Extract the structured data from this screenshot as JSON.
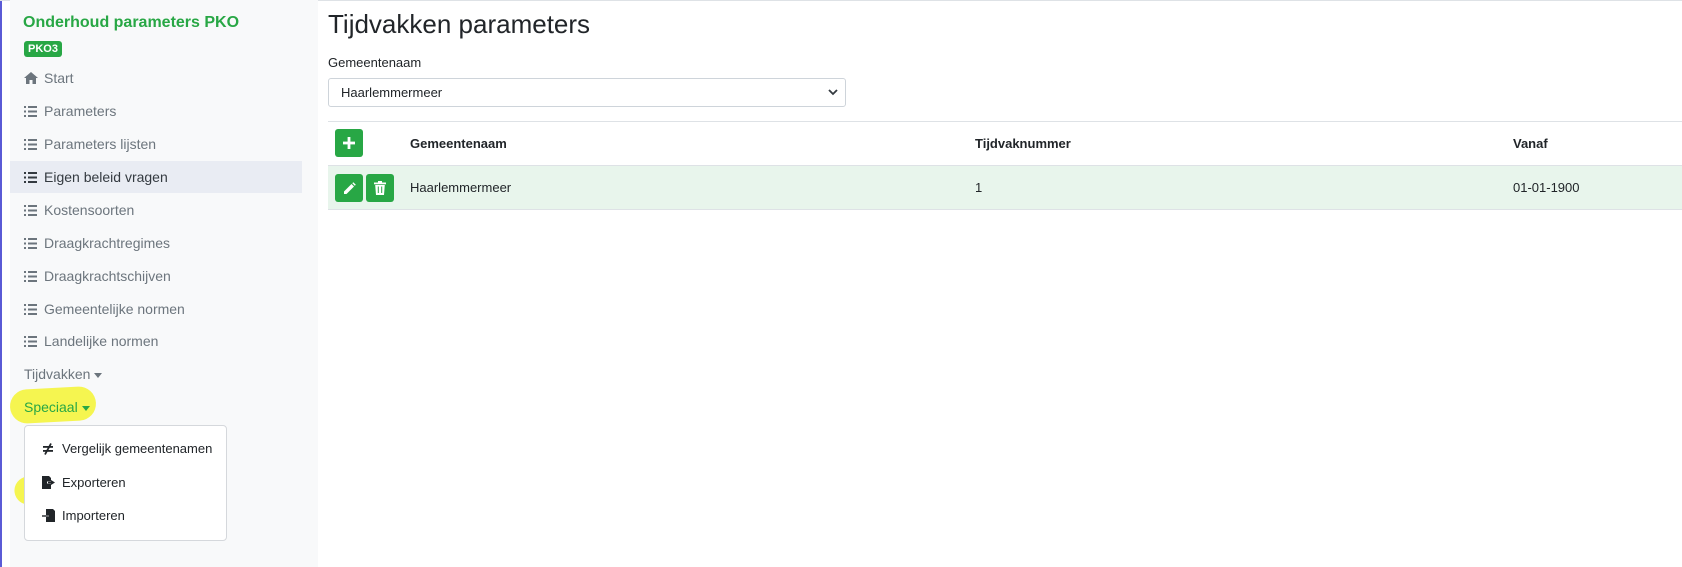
{
  "sidebar": {
    "title": "Onderhoud parameters PKO",
    "badge": "PKO3",
    "items": [
      {
        "label": "Start",
        "icon": "home-icon"
      },
      {
        "label": "Parameters",
        "icon": "list-icon"
      },
      {
        "label": "Parameters lijsten",
        "icon": "list-icon"
      },
      {
        "label": "Eigen beleid vragen",
        "icon": "list-icon"
      },
      {
        "label": "Kostensoorten",
        "icon": "list-icon"
      },
      {
        "label": "Draagkrachtregimes",
        "icon": "list-icon"
      },
      {
        "label": "Draagkrachtschijven",
        "icon": "list-icon"
      },
      {
        "label": "Gemeentelijke normen",
        "icon": "list-icon"
      },
      {
        "label": "Landelijke normen",
        "icon": "list-icon"
      }
    ],
    "dropdowns": [
      {
        "label": "Tijdvakken"
      },
      {
        "label": "Speciaal"
      }
    ],
    "speciaal_menu": [
      {
        "label": "Vergelijk gemeentenamen",
        "icon": "not-equal-icon"
      },
      {
        "label": "Exporteren",
        "icon": "file-export-icon"
      },
      {
        "label": "Importeren",
        "icon": "file-import-icon"
      }
    ]
  },
  "main": {
    "title": "Tijdvakken parameters",
    "filter": {
      "label": "Gemeentenaam",
      "value": "Haarlemmermeer"
    },
    "table": {
      "columns": [
        "Gemeentenaam",
        "Tijdvaknummer",
        "Vanaf"
      ],
      "rows": [
        {
          "gemeentenaam": "Haarlemmermeer",
          "tijdvaknummer": "1",
          "vanaf": "01-01-1900"
        }
      ]
    }
  },
  "colors": {
    "accent": "#28a745",
    "highlight": "#f5f531",
    "row_bg": "#e8f5ec"
  }
}
